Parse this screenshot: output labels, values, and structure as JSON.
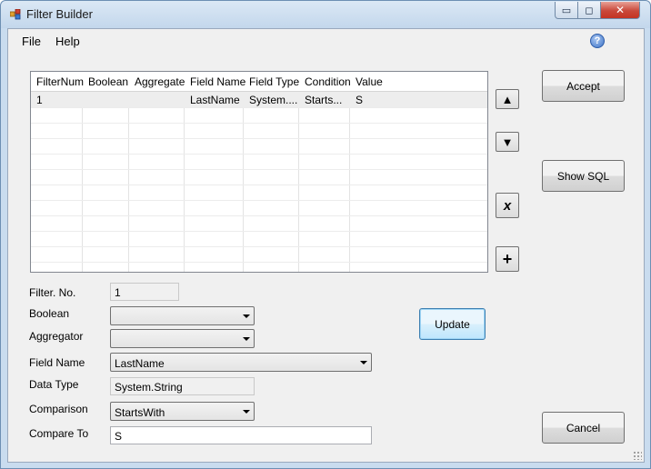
{
  "window": {
    "title": "Filter Builder",
    "minimize_glyph": "▭",
    "maximize_glyph": "◻",
    "close_glyph": "✕"
  },
  "menu": {
    "items": [
      "File",
      "Help"
    ],
    "help_icon_glyph": "?"
  },
  "grid": {
    "columns": [
      "FilterNum",
      "Boolean",
      "Aggregate",
      "Field Name",
      "Field Type",
      "Condition",
      "Value"
    ],
    "rows": [
      [
        "1",
        "",
        "",
        "LastName",
        "System....",
        "Starts...",
        "S"
      ]
    ]
  },
  "side_buttons": {
    "up": "▲",
    "down": "▼",
    "delete": "x",
    "add": "+"
  },
  "buttons": {
    "accept": "Accept",
    "show_sql": "Show SQL",
    "update": "Update",
    "cancel": "Cancel"
  },
  "form": {
    "filter_no": {
      "label": "Filter. No.",
      "value": "1"
    },
    "boolean": {
      "label": "Boolean",
      "value": ""
    },
    "aggregator": {
      "label": "Aggregator",
      "value": ""
    },
    "field_name": {
      "label": "Field Name",
      "value": "LastName"
    },
    "data_type": {
      "label": "Data Type",
      "value": "System.String"
    },
    "comparison": {
      "label": "Comparison",
      "value": "StartsWith"
    },
    "compare_to": {
      "label": "Compare To",
      "value": "S"
    }
  },
  "colors": {
    "title_bar": "#c9dcef",
    "close_button": "#c43322",
    "selected_row": "#ededed",
    "focused_button_border": "#3c7fb1"
  }
}
